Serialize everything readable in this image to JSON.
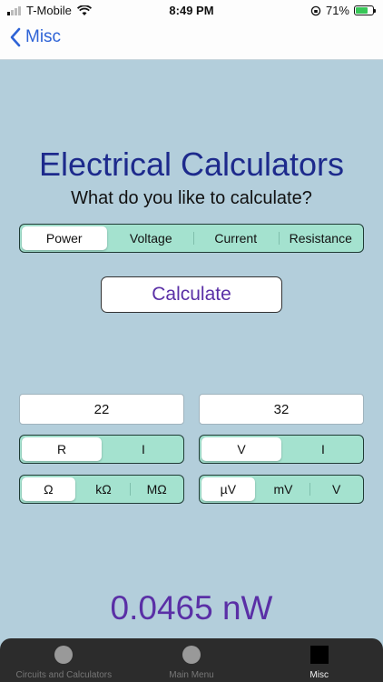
{
  "status": {
    "carrier": "T-Mobile",
    "time": "8:49 PM",
    "battery": "71%",
    "battery_level": 0.71
  },
  "nav": {
    "back_label": "Misc"
  },
  "title": "Electrical Calculators",
  "subtitle": "What do you like to calculate?",
  "mode_tabs": {
    "options": [
      "Power",
      "Voltage",
      "Current",
      "Resistance"
    ],
    "selected": "Power"
  },
  "calculate_label": "Calculate",
  "inputs": {
    "left_value": "22",
    "right_value": "32"
  },
  "left_quantity": {
    "options": [
      "R",
      "I"
    ],
    "selected": "R"
  },
  "right_quantity": {
    "options": [
      "V",
      "I"
    ],
    "selected": "V"
  },
  "left_unit": {
    "options": [
      "Ω",
      "kΩ",
      "MΩ"
    ],
    "selected": "Ω"
  },
  "right_unit": {
    "options": [
      "µV",
      "mV",
      "V"
    ],
    "selected": "µV"
  },
  "result": "0.0465 nW",
  "tabs": [
    {
      "label": "Circuits and Calculators",
      "icon": "circle-icon"
    },
    {
      "label": "Main Menu",
      "icon": "circle-icon"
    },
    {
      "label": "Misc",
      "icon": "square-icon"
    }
  ],
  "active_tab": "Misc"
}
